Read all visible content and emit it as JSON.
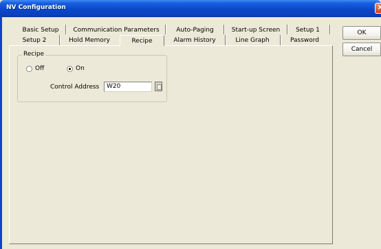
{
  "window": {
    "title": "NV Configuration"
  },
  "tabs": {
    "row1": [
      "Basic Setup",
      "Communication Parameters",
      "Auto-Paging",
      "Start-up Screen",
      "Setup 1"
    ],
    "row2": [
      "Setup 2",
      "Hold Memory",
      "Recipe",
      "Alarm History",
      "Line Graph",
      "Password"
    ],
    "active": "Recipe"
  },
  "recipe": {
    "group_label": "Recipe",
    "off_label": "Off",
    "on_label": "On",
    "selected": "On",
    "control_address_label": "Control Address",
    "control_address_value": "W20"
  },
  "buttons": {
    "ok": "OK",
    "cancel": "Cancel"
  },
  "colors": {
    "titlebar": "#0a47c9",
    "background": "#ece9d8"
  }
}
